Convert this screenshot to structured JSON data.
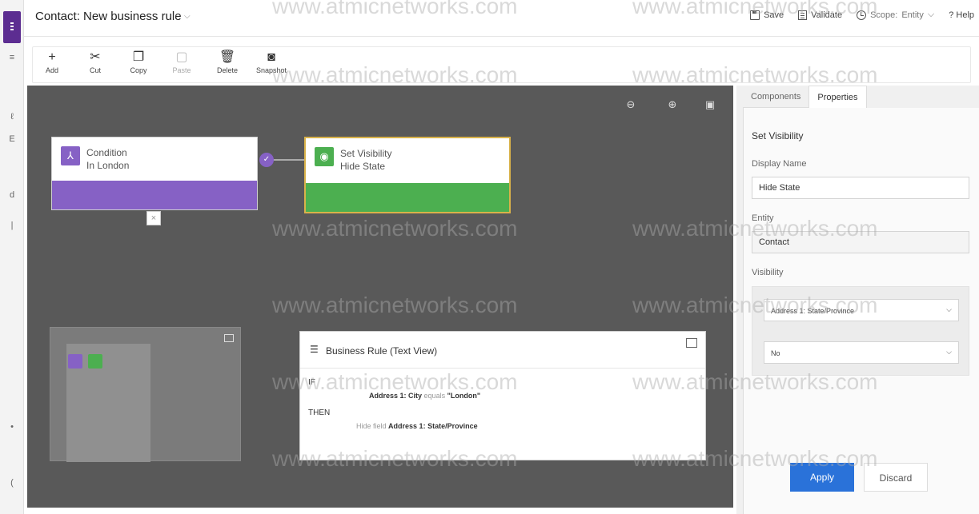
{
  "header": {
    "title": "Contact: New business rule",
    "actions": {
      "save": "Save",
      "validate": "Validate",
      "scope_label": "Scope:",
      "scope_value": "Entity",
      "help": "? Help"
    }
  },
  "toolbar": {
    "add": "Add",
    "cut": "Cut",
    "copy": "Copy",
    "paste": "Paste",
    "delete": "Delete",
    "snapshot": "Snapshot"
  },
  "canvas": {
    "condition_node": {
      "title": "Condition",
      "subtitle": "In London"
    },
    "action_node": {
      "title": "Set Visibility",
      "subtitle": "Hide State"
    }
  },
  "text_view": {
    "title": "Business Rule (Text View)",
    "if_label": "IF",
    "then_label": "THEN",
    "condition": {
      "field": "Address 1: City",
      "operator": "equals",
      "value": "\"London\""
    },
    "action": {
      "verb": "Hide field",
      "field": "Address 1: State/Province"
    }
  },
  "properties_panel": {
    "tabs": [
      "Components",
      "Properties"
    ],
    "active_tab": "Properties",
    "section_title": "Set Visibility",
    "display_name_label": "Display Name",
    "display_name_value": "Hide State",
    "entity_label": "Entity",
    "entity_value": "Contact",
    "visibility_label": "Visibility",
    "visibility_field": "Address 1: State/Province",
    "visibility_value": "No",
    "apply": "Apply",
    "discard": "Discard"
  },
  "watermark": "www.atmicnetworks.com",
  "colors": {
    "condition_accent": "#8661c5",
    "action_accent": "#4caf50",
    "selected_border": "#d9b24a",
    "canvas_bg": "#595959",
    "apply_button": "#2a72d9"
  }
}
